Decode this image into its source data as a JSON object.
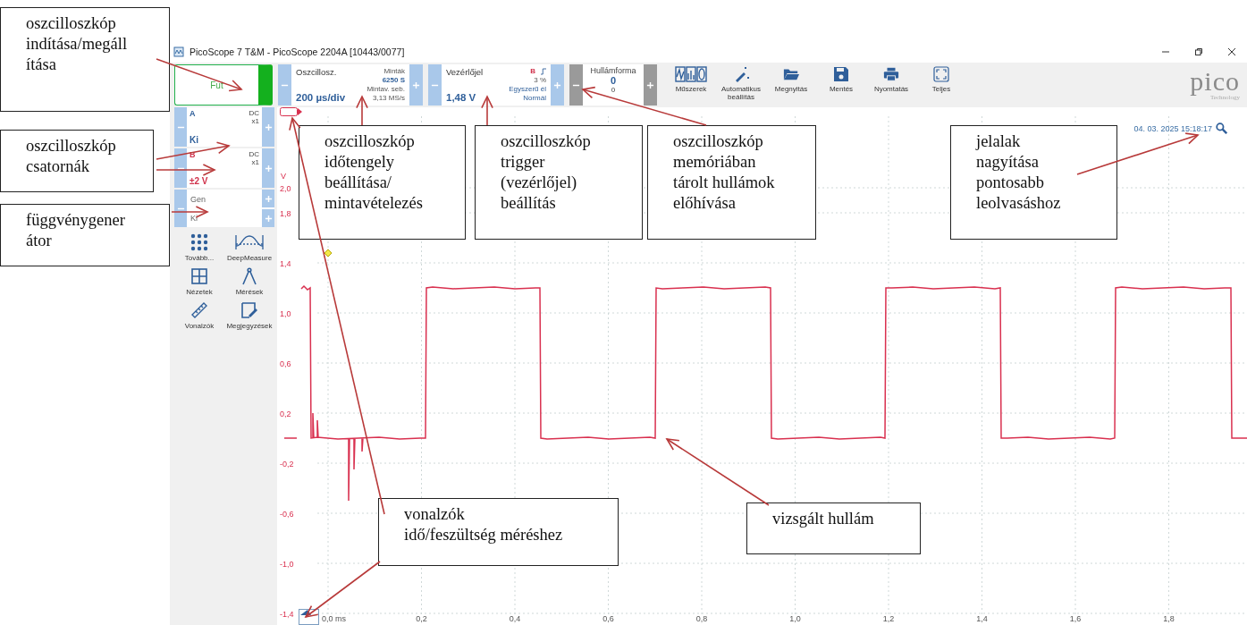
{
  "window": {
    "title": "PicoScope 7 T&M  - PicoScope 2204A [10443/0077]"
  },
  "run_button": {
    "label": "Fut"
  },
  "timebase": {
    "label": "Oszcillosz.",
    "value": "200 µs/div",
    "samples_label": "Minták",
    "samples": "6250 S",
    "rate_label": "Mintav. seb.",
    "rate": "3,13 MS/s"
  },
  "trigger": {
    "label": "Vezérlőjel",
    "value": "1,48 V",
    "channel": "B",
    "pre_trigger": "3 %",
    "type": "Egyszerű él",
    "mode": "Normál"
  },
  "waveform_buffer": {
    "label": "Hullámforma",
    "value": "0",
    "total": "0",
    "disabled": true
  },
  "tools": [
    {
      "label": "Műszerek",
      "kind": "instruments"
    },
    {
      "label": "Automatikus beállítás",
      "kind": "autosetup"
    },
    {
      "label": "Megnyitás",
      "kind": "open"
    },
    {
      "label": "Mentés",
      "kind": "save"
    },
    {
      "label": "Nyomtatás",
      "kind": "print"
    },
    {
      "label": "Teljes",
      "kind": "fullscreen"
    }
  ],
  "logo": {
    "name": "pico",
    "tagline": "Technology"
  },
  "channels": [
    {
      "name": "A",
      "coupling": "DC",
      "probe": "x1",
      "range": "Ki",
      "color": "#2f5f9a"
    },
    {
      "name": "B",
      "coupling": "DC",
      "probe": "x1",
      "range": "±2 V",
      "color": "#d0324b"
    }
  ],
  "generator": {
    "label": "Gen",
    "value": "Ki"
  },
  "side_tools": [
    {
      "label": "Tovább...",
      "kind": "more"
    },
    {
      "label": "DeepMeasure",
      "kind": "deepmeasure"
    },
    {
      "label": "Nézetek",
      "kind": "views"
    },
    {
      "label": "Mérések",
      "kind": "measurements"
    },
    {
      "label": "Vonalzók",
      "kind": "rulers"
    },
    {
      "label": "Megjegyzések",
      "kind": "notes"
    }
  ],
  "plot": {
    "timestamp": "04. 03. 2025 15:18:17",
    "y_unit": "V",
    "y_labels": [
      "2,0",
      "1,8",
      "1,4",
      "1,0",
      "0,6",
      "0,2",
      "-0,2",
      "-0,6",
      "-1,0",
      "-1,4"
    ],
    "x_labels": [
      "0,0 ms",
      "0,2",
      "0,4",
      "0,6",
      "0,8",
      "1,0",
      "1,2",
      "1,4",
      "1,6",
      "1,8"
    ]
  },
  "callouts": [
    {
      "lines": [
        "oszcilloszkóp",
        "indítása/megáll",
        "ítása"
      ]
    },
    {
      "lines": [
        "oszcilloszkóp",
        "csatornák"
      ]
    },
    {
      "lines": [
        "függvénygener",
        "átor"
      ]
    },
    {
      "lines": [
        "oszcilloszkóp",
        "időtengely",
        "beállítása/",
        "mintavételezés"
      ]
    },
    {
      "lines": [
        "oszcilloszkóp",
        "trigger",
        "(vezérlőjel)",
        "beállítás"
      ]
    },
    {
      "lines": [
        "oszcilloszkóp",
        "memóriában",
        "tárolt hullámok",
        "előhívása"
      ]
    },
    {
      "lines": [
        "jelalak",
        "nagyítása",
        "pontosabb",
        "leolvasáshoz"
      ]
    },
    {
      "lines": [
        "vonalzók",
        "idő/feszültség  méréshez"
      ]
    },
    {
      "lines": [
        "vizsgált hullám"
      ]
    }
  ]
}
